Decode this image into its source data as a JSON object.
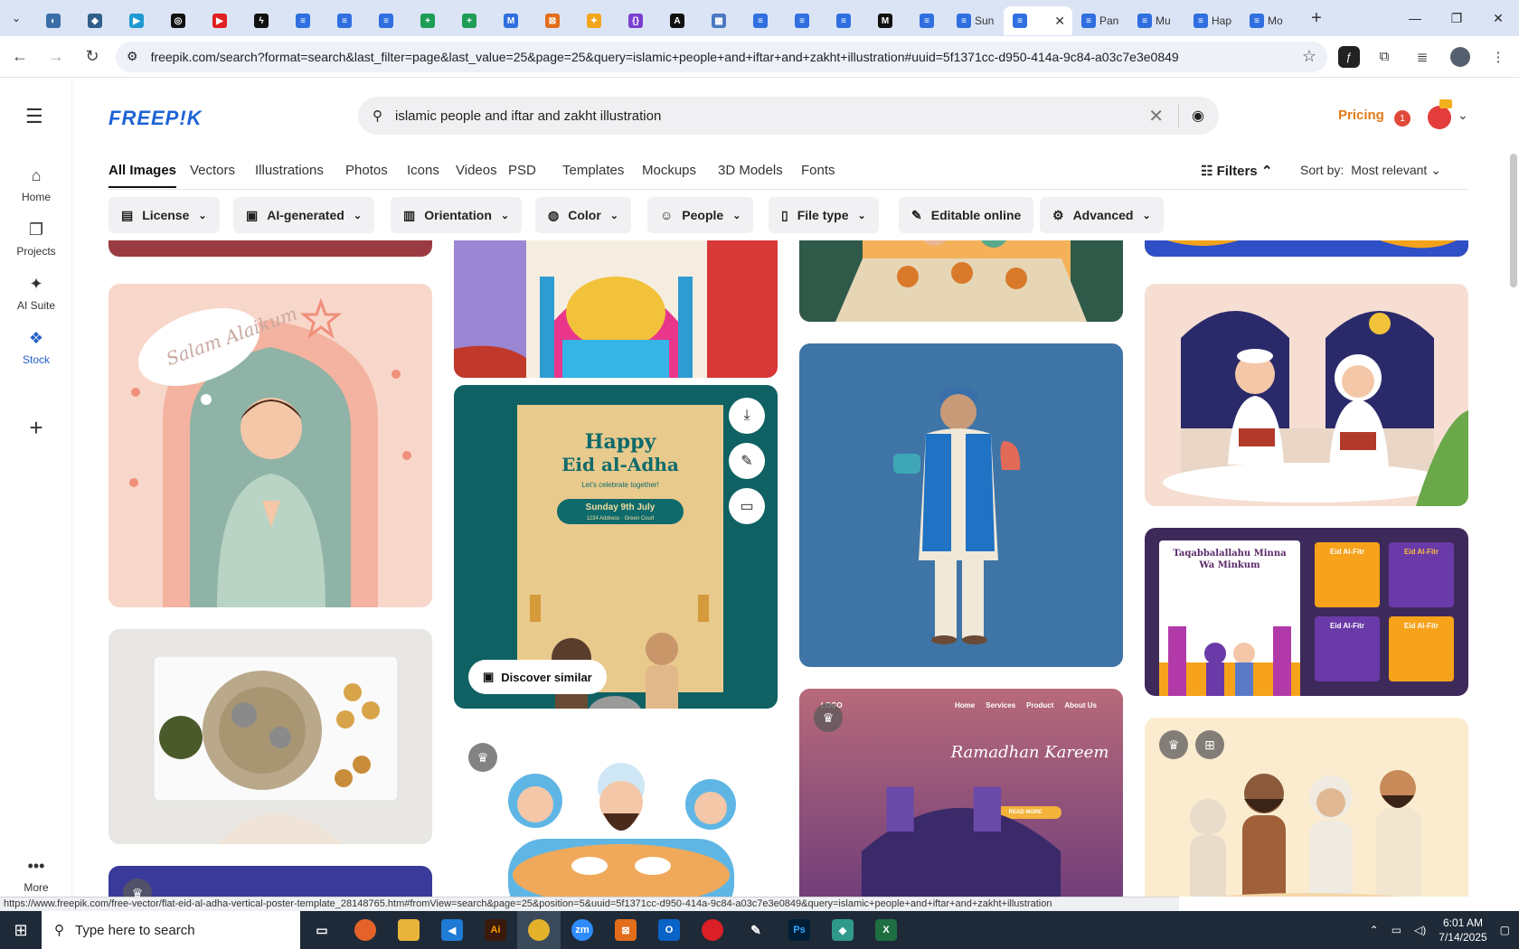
{
  "browser": {
    "tabs": [
      {
        "label": "",
        "color": "#3b6ea8",
        "glyph": "◐"
      },
      {
        "label": "",
        "color": "#2f5f8a",
        "glyph": "◆"
      },
      {
        "label": "",
        "color": "#1f9bd2",
        "glyph": "▶"
      },
      {
        "label": "",
        "color": "#111111",
        "glyph": "◎"
      },
      {
        "label": "",
        "color": "#e02020",
        "glyph": "▶"
      },
      {
        "label": "",
        "color": "#111111",
        "glyph": "ϟ"
      },
      {
        "label": "",
        "color": "#2f6fe0",
        "glyph": "≡"
      },
      {
        "label": "",
        "color": "#2f6fe0",
        "glyph": "≡"
      },
      {
        "label": "",
        "color": "#2f6fe0",
        "glyph": "≡"
      },
      {
        "label": "",
        "color": "#1f9d55",
        "glyph": "+"
      },
      {
        "label": "",
        "color": "#1f9d55",
        "glyph": "+"
      },
      {
        "label": "",
        "color": "#2f6fe0",
        "glyph": "M"
      },
      {
        "label": "",
        "color": "#e26d1b",
        "glyph": "⊠"
      },
      {
        "label": "",
        "color": "#f2a61d",
        "glyph": "✦"
      },
      {
        "label": "",
        "color": "#7a3fd0",
        "glyph": "{}"
      },
      {
        "label": "",
        "color": "#111111",
        "glyph": "A"
      },
      {
        "label": "",
        "color": "#4a78c2",
        "glyph": "▦"
      },
      {
        "label": "",
        "color": "#2f6fe0",
        "glyph": "≡"
      },
      {
        "label": "",
        "color": "#2f6fe0",
        "glyph": "≡"
      },
      {
        "label": "",
        "color": "#2f6fe0",
        "glyph": "≡"
      },
      {
        "label": "",
        "color": "#111111",
        "glyph": "M"
      },
      {
        "label": "",
        "color": "#2f6fe0",
        "glyph": "≡"
      }
    ],
    "named_tabs": [
      {
        "label": "Sun",
        "color": "#2f6fe0"
      },
      {
        "label": "",
        "color": "#2f6fe0",
        "active": true
      },
      {
        "label": "Pan",
        "color": "#2f6fe0"
      },
      {
        "label": "Mu",
        "color": "#2f6fe0"
      },
      {
        "label": "Hap",
        "color": "#2f6fe0"
      },
      {
        "label": "Mo",
        "color": "#2f6fe0"
      }
    ],
    "url": "freepik.com/search?format=search&last_filter=page&last_value=25&page=25&query=islamic+people+and+iftar+and+zakht+illustration#uuid=5f1371cc-d950-414a-9c84-a03c7e3e0849",
    "status_url": "https://www.freepik.com/free-vector/flat-eid-al-adha-vertical-poster-template_28148765.htm#fromView=search&page=25&position=5&uuid=5f1371cc-d950-414a-9c84-a03c7e3e0849&query=islamic+people+and+iftar+and+zakht+illustration"
  },
  "nav": {
    "items": [
      {
        "label": "Home",
        "icon": "home-icon",
        "glyph": "⌂"
      },
      {
        "label": "Projects",
        "icon": "projects-icon",
        "glyph": "❐"
      },
      {
        "label": "AI Suite",
        "icon": "ai-suite-icon",
        "glyph": "✦"
      },
      {
        "label": "Stock",
        "icon": "stock-icon",
        "glyph": "❖"
      }
    ],
    "add_glyph": "+",
    "more_label": "More"
  },
  "header": {
    "logo": "FREEP!K",
    "search_query": "islamic people and iftar and zakht illustration",
    "pricing": "Pricing",
    "notification_count": "1"
  },
  "content_tabs": [
    "All Images",
    "Vectors",
    "Illustrations",
    "Photos",
    "Icons",
    "Videos",
    "PSD",
    "Templates",
    "Mockups",
    "3D Models",
    "Fonts"
  ],
  "filters_label": "Filters",
  "sort": {
    "label": "Sort by:",
    "value": "Most relevant"
  },
  "filter_buttons": [
    "License",
    "AI-generated",
    "Orientation",
    "Color",
    "People",
    "File type",
    "Editable online",
    "Advanced"
  ],
  "cards": {
    "salam_text": "Salam Alaikum",
    "poster_title": "Happy",
    "poster_title2": "Eid al-Adha",
    "poster_sub": "Let's celebrate together!",
    "poster_date": "Sunday 9th July",
    "poster_addr": "1234 Address · Green Court",
    "discover_label": "Discover similar",
    "web_logo": "LOGO",
    "web_nav": [
      "Home",
      "Services",
      "Product",
      "About Us"
    ],
    "web_title": "Ramadhan Kareem",
    "web_button": "READ MORE",
    "taq_title": "Taqabbalallahu Minna Wa Minkum",
    "eid_fitr": "Eid Al-Fitr"
  },
  "taskbar": {
    "search_placeholder": "Type here to search",
    "time": "6:01 AM",
    "date": "7/14/2025"
  }
}
